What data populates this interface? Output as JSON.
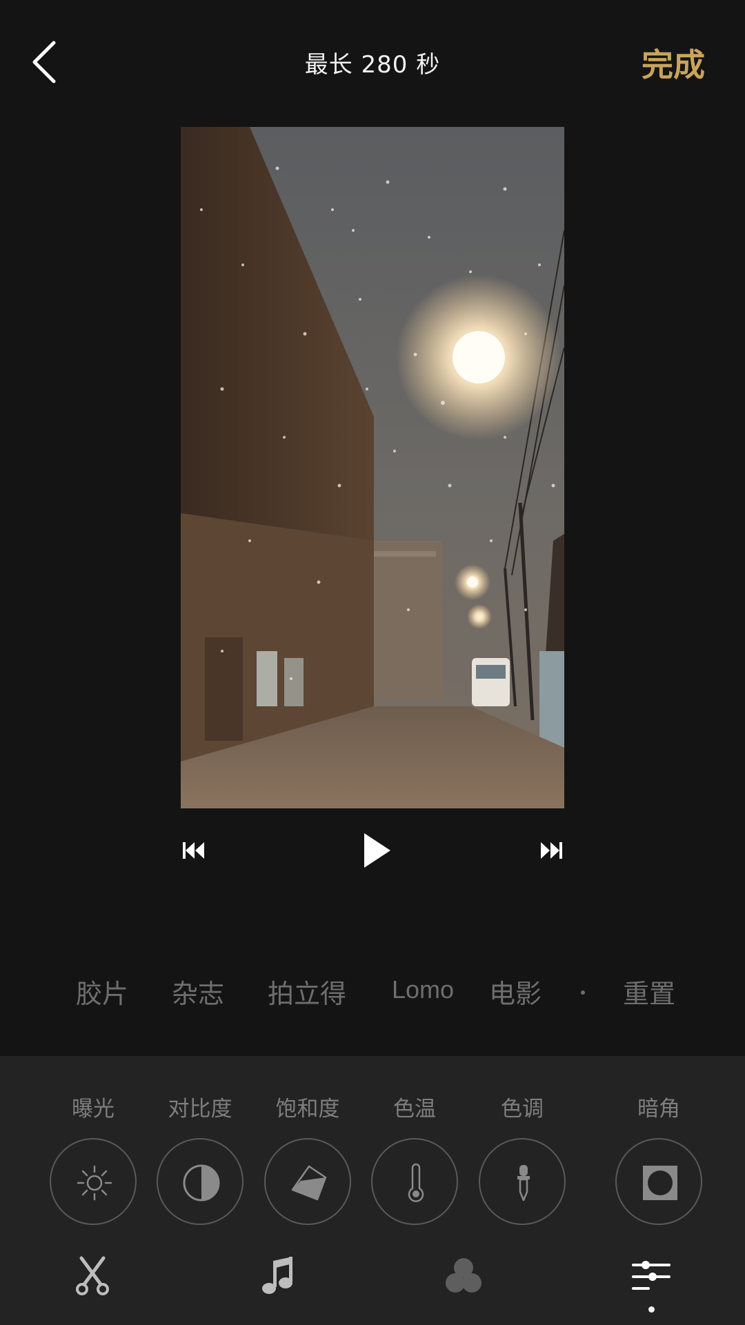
{
  "header": {
    "title": "最长 280 秒",
    "done_label": "完成",
    "back_icon": "chevron-left-icon"
  },
  "player": {
    "prev_icon": "skip-previous-icon",
    "play_icon": "play-icon",
    "next_icon": "skip-next-icon"
  },
  "filters": {
    "items": [
      "胶片",
      "杂志",
      "拍立得",
      "Lomo",
      "电影"
    ],
    "reset_label": "重置"
  },
  "adjustments": [
    {
      "label": "曝光",
      "icon": "sun-icon"
    },
    {
      "label": "对比度",
      "icon": "contrast-icon"
    },
    {
      "label": "饱和度",
      "icon": "droplet-icon"
    },
    {
      "label": "色温",
      "icon": "thermometer-icon"
    },
    {
      "label": "色调",
      "icon": "pipette-icon"
    },
    {
      "label": "暗角",
      "icon": "vignette-icon"
    }
  ],
  "tabs": [
    {
      "icon": "scissors-icon"
    },
    {
      "icon": "music-note-icon"
    },
    {
      "icon": "filter-circles-icon"
    },
    {
      "icon": "sliders-icon",
      "active": true
    }
  ],
  "colors": {
    "accent": "#c9a45a",
    "background": "#141414",
    "panel": "#232323"
  }
}
